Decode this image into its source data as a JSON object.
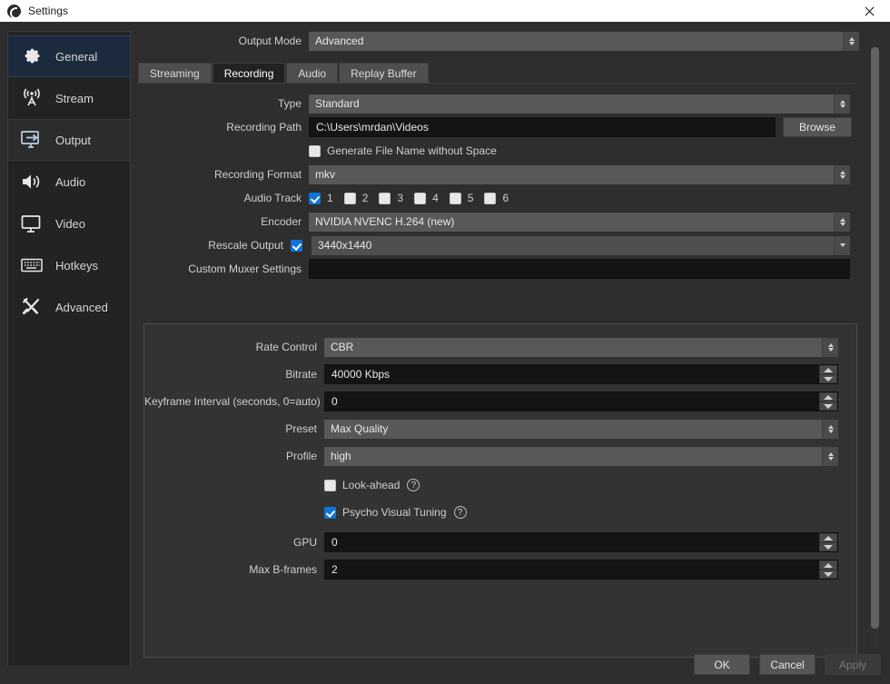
{
  "window": {
    "title": "Settings",
    "app_icon": "obs-logo-icon",
    "close_label": "×"
  },
  "sidebar": {
    "items": [
      {
        "label": "General",
        "icon": "gear-icon",
        "state": "highlight"
      },
      {
        "label": "Stream",
        "icon": "broadcast-icon",
        "state": "normal"
      },
      {
        "label": "Output",
        "icon": "output-icon",
        "state": "current"
      },
      {
        "label": "Audio",
        "icon": "speaker-icon",
        "state": "normal"
      },
      {
        "label": "Video",
        "icon": "monitor-icon",
        "state": "normal"
      },
      {
        "label": "Hotkeys",
        "icon": "keyboard-icon",
        "state": "normal"
      },
      {
        "label": "Advanced",
        "icon": "tools-icon",
        "state": "normal"
      }
    ]
  },
  "output": {
    "mode_label": "Output Mode",
    "mode_value": "Advanced",
    "tabs": [
      {
        "label": "Streaming",
        "active": false
      },
      {
        "label": "Recording",
        "active": true
      },
      {
        "label": "Audio",
        "active": false
      },
      {
        "label": "Replay Buffer",
        "active": false
      }
    ],
    "recording": {
      "type_label": "Type",
      "type_value": "Standard",
      "path_label": "Recording Path",
      "path_value": "C:\\Users\\mrdan\\Videos",
      "browse_label": "Browse",
      "generate_no_space_label": "Generate File Name without Space",
      "generate_no_space_checked": false,
      "format_label": "Recording Format",
      "format_value": "mkv",
      "audio_track_label": "Audio Track",
      "audio_tracks": [
        {
          "label": "1",
          "checked": true
        },
        {
          "label": "2",
          "checked": false
        },
        {
          "label": "3",
          "checked": false
        },
        {
          "label": "4",
          "checked": false
        },
        {
          "label": "5",
          "checked": false
        },
        {
          "label": "6",
          "checked": false
        }
      ],
      "encoder_label": "Encoder",
      "encoder_value": "NVIDIA NVENC H.264 (new)",
      "rescale_label": "Rescale Output",
      "rescale_checked": true,
      "rescale_value": "3440x1440",
      "muxer_label": "Custom Muxer Settings",
      "muxer_value": ""
    },
    "encoder_settings": {
      "rate_control_label": "Rate Control",
      "rate_control_value": "CBR",
      "bitrate_label": "Bitrate",
      "bitrate_value": "40000 Kbps",
      "keyframe_label": "Keyframe Interval (seconds, 0=auto)",
      "keyframe_value": "0",
      "preset_label": "Preset",
      "preset_value": "Max Quality",
      "profile_label": "Profile",
      "profile_value": "high",
      "lookahead_label": "Look-ahead",
      "lookahead_checked": false,
      "lookahead_help": "?",
      "psycho_label": "Psycho Visual Tuning",
      "psycho_checked": true,
      "psycho_help": "?",
      "gpu_label": "GPU",
      "gpu_value": "0",
      "bframes_label": "Max B-frames",
      "bframes_value": "2"
    }
  },
  "footer": {
    "ok_label": "OK",
    "cancel_label": "Cancel",
    "apply_label": "Apply"
  },
  "colors": {
    "accent_checkbox": "#1273d6",
    "sidebar_highlight": "#1b2a3d",
    "window_bg": "#2e2e2e"
  }
}
